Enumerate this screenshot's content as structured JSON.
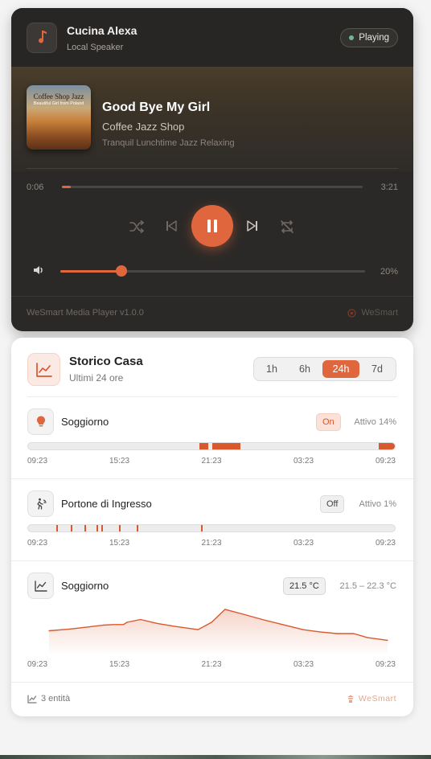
{
  "player": {
    "speaker_name": "Cucina Alexa",
    "speaker_type": "Local Speaker",
    "status": "Playing",
    "track_title": "Good Bye My Girl",
    "artist": "Coffee Jazz Shop",
    "album": "Tranquil Lunchtime Jazz Relaxing",
    "cover_line1": "Coffee Shop Jazz",
    "cover_line2": "Beautiful Girl from Poland",
    "position": "0:06",
    "duration": "3:21",
    "progress": 0.03,
    "volume_label": "20%",
    "volume": 0.2,
    "version": "WeSmart Media Player v1.0.0",
    "brand": "WeSmart",
    "accent": "#e0663e"
  },
  "history": {
    "title": "Storico Casa",
    "subtitle": "Ultimi 24 ore",
    "ranges": [
      "1h",
      "6h",
      "24h",
      "7d"
    ],
    "active_range": "24h",
    "axis_labels": [
      "09:23",
      "15:23",
      "21:23",
      "03:23",
      "09:23"
    ],
    "entities": [
      {
        "name": "Soggiorno",
        "icon": "lightbulb-icon",
        "state": "On",
        "meta": "Attivo 14%",
        "on_intervals": [
          [
            0.467,
            0.492
          ],
          [
            0.502,
            0.578
          ],
          [
            0.957,
            1.0
          ]
        ]
      },
      {
        "name": "Portone di Ingresso",
        "icon": "person-walking-icon",
        "state": "Off",
        "meta": "Attivo 1%",
        "events": [
          0.077,
          0.117,
          0.154,
          0.186,
          0.2,
          0.247,
          0.297,
          0.471
        ]
      },
      {
        "name": "Soggiorno",
        "icon": "line-chart-icon",
        "state": "21.5 °C",
        "meta": "21.5 – 22.3 °C"
      }
    ],
    "footer_count": "3 entità",
    "footer_brand": "WeSmart"
  },
  "chart_data": {
    "type": "area",
    "title": "",
    "xlabel": "",
    "ylabel": "",
    "x": [
      0,
      0.06,
      0.12,
      0.16,
      0.19,
      0.22,
      0.23,
      0.27,
      0.32,
      0.37,
      0.44,
      0.48,
      0.52,
      0.57,
      0.63,
      0.69,
      0.75,
      0.8,
      0.85,
      0.9,
      0.94,
      1.0
    ],
    "series": [
      {
        "values": [
          21.85,
          21.88,
          21.92,
          21.95,
          21.96,
          21.96,
          22.0,
          22.05,
          21.98,
          21.93,
          21.87,
          22.0,
          22.23,
          22.15,
          22.05,
          21.96,
          21.87,
          21.83,
          21.8,
          21.8,
          21.73,
          21.68
        ]
      }
    ],
    "ylim": [
      21.5,
      22.3
    ],
    "x_tick_labels": [
      "09:23",
      "15:23",
      "21:23",
      "03:23",
      "09:23"
    ],
    "grid": false
  }
}
